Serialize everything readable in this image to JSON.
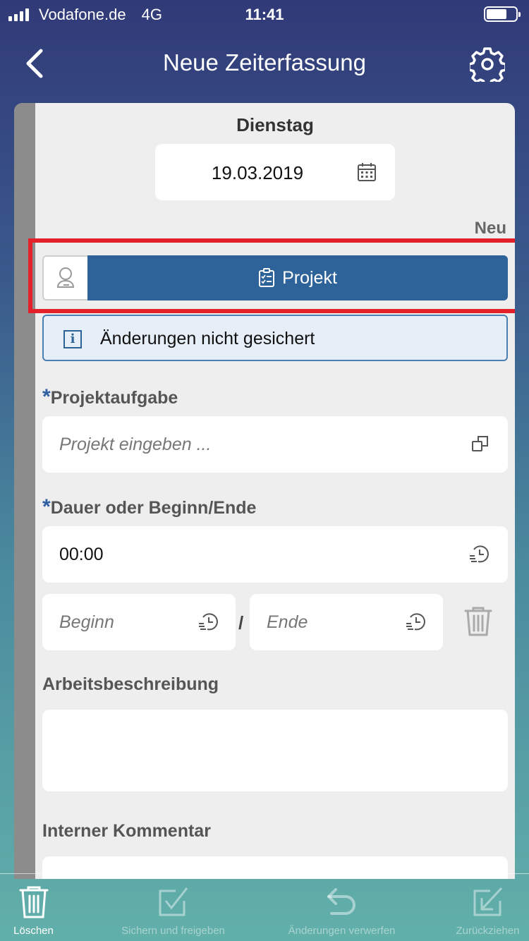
{
  "status_bar": {
    "carrier": "Vodafone.de",
    "network": "4G",
    "time": "11:41"
  },
  "header": {
    "title": "Neue Zeiterfassung"
  },
  "form": {
    "day_name": "Dienstag",
    "date": "19.03.2019",
    "status": "Neu",
    "project_button_label": "Projekt",
    "info_message": "Änderungen nicht gesichert",
    "required_mark": "*",
    "project_task": {
      "label": "Projektaufgabe",
      "placeholder": "Projekt eingeben ..."
    },
    "duration": {
      "label": "Dauer oder Beginn/Ende",
      "value": "00:00",
      "begin_placeholder": "Beginn",
      "end_placeholder": "Ende",
      "separator": "/"
    },
    "work_description": {
      "label": "Arbeitsbeschreibung",
      "value": ""
    },
    "internal_comment": {
      "label": "Interner Kommentar",
      "value": ""
    }
  },
  "toolbar": {
    "items": [
      {
        "label": "Löschen",
        "icon": "trash-icon",
        "enabled": true
      },
      {
        "label": "Sichern und freigeben",
        "icon": "check-save-icon",
        "enabled": false
      },
      {
        "label": "Änderungen verwerfen",
        "icon": "undo-icon",
        "enabled": false
      },
      {
        "label": "Zurückziehen",
        "icon": "withdraw-icon",
        "enabled": false
      }
    ]
  },
  "colors": {
    "accent": "#2e6399",
    "highlight": "#e4202b",
    "required": "#2e5fa0"
  }
}
